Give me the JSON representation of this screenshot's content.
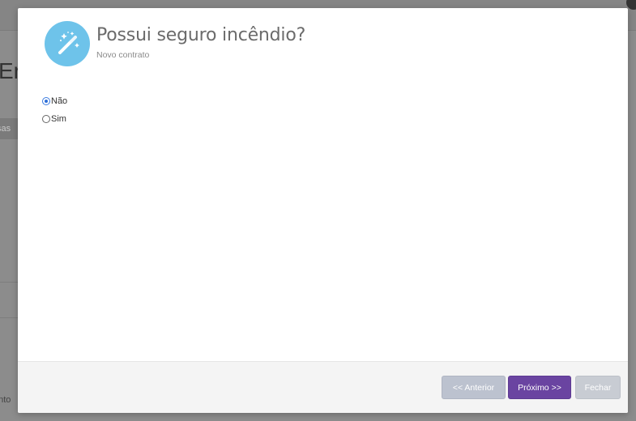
{
  "background": {
    "heading_fragment": "Er",
    "tab_fragment": "sas",
    "footer_fragment": "ento"
  },
  "modal": {
    "icon": "magic-wand-icon",
    "icon_color": "#6ec3ea",
    "title": "Possui seguro incêndio?",
    "subtitle": "Novo contrato",
    "options": [
      {
        "label": "Não",
        "checked": true
      },
      {
        "label": "Sim",
        "checked": false
      }
    ],
    "buttons": {
      "previous": "<< Anterior",
      "next": "Próximo >>",
      "close": "Fechar"
    },
    "colors": {
      "next_button": "#6a44a1",
      "previous_button": "#bcc2cf",
      "close_button": "#c8ccd3"
    }
  }
}
